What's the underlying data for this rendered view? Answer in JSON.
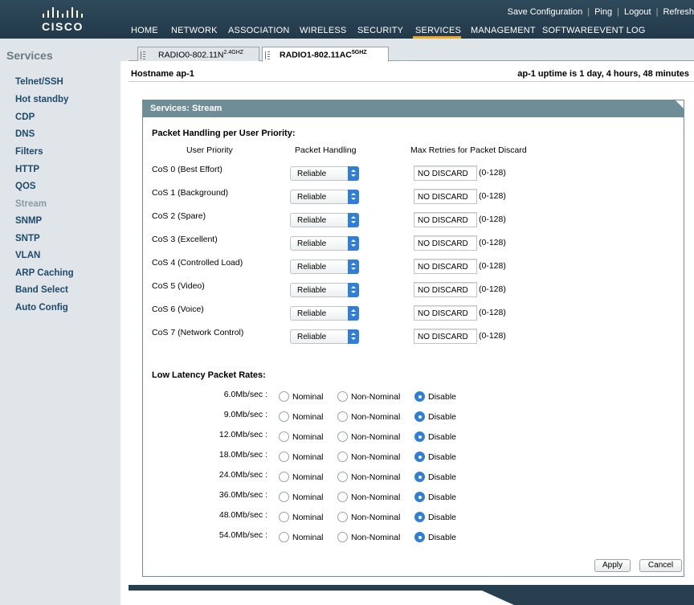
{
  "brand": {
    "name": "CISCO"
  },
  "top_links": [
    "Save Configuration",
    "Ping",
    "Logout",
    "Refresh"
  ],
  "nav": [
    "HOME",
    "NETWORK",
    "ASSOCIATION",
    "WIRELESS",
    "SECURITY",
    "SERVICES",
    "MANAGEMENT",
    "SOFTWARE",
    "EVENT LOG"
  ],
  "nav_active": "SERVICES",
  "accent": "#f5a623",
  "sidebar": {
    "title": "Services",
    "items": [
      "Telnet/SSH",
      "Hot standby",
      "CDP",
      "DNS",
      "Filters",
      "HTTP",
      "QOS",
      "Stream",
      "SNMP",
      "SNTP",
      "VLAN",
      "ARP Caching",
      "Band Select",
      "Auto Config"
    ],
    "current": "Stream"
  },
  "tabs": [
    {
      "label": "RADIO0-802.11N",
      "sup": "2.4GHZ"
    },
    {
      "label": "RADIO1-802.11AC",
      "sup": "5GHZ"
    }
  ],
  "hostname": "Hostname  ap-1",
  "uptime": "ap-1 uptime is 1 day, 4 hours, 48 minutes",
  "panel": {
    "title": "Services: Stream",
    "priority_section": "Packet Handling per User Priority:",
    "col_user_priority": "User Priority",
    "col_packet_handling": "Packet Handling",
    "col_max_retries": "Max Retries for Packet Discard",
    "rows": [
      {
        "cos": "CoS 0 (Best Effort)",
        "handling": "Reliable",
        "retries": "NO DISCARD",
        "range": "(0-128)"
      },
      {
        "cos": "CoS 1 (Background)",
        "handling": "Reliable",
        "retries": "NO DISCARD",
        "range": "(0-128)"
      },
      {
        "cos": "CoS 2 (Spare)",
        "handling": "Reliable",
        "retries": "NO DISCARD",
        "range": "(0-128)"
      },
      {
        "cos": "CoS 3 (Excellent)",
        "handling": "Reliable",
        "retries": "NO DISCARD",
        "range": "(0-128)"
      },
      {
        "cos": "CoS 4 (Controlled Load)",
        "handling": "Reliable",
        "retries": "NO DISCARD",
        "range": "(0-128)"
      },
      {
        "cos": "CoS 5 (Video)",
        "handling": "Reliable",
        "retries": "NO DISCARD",
        "range": "(0-128)"
      },
      {
        "cos": "CoS 6 (Voice)",
        "handling": "Reliable",
        "retries": "NO DISCARD",
        "range": "(0-128)"
      },
      {
        "cos": "CoS 7 (Network Control)",
        "handling": "Reliable",
        "retries": "NO DISCARD",
        "range": "(0-128)"
      }
    ],
    "latency_section": "Low Latency Packet Rates:",
    "rate_options": [
      "Nominal",
      "Non-Nominal",
      "Disable"
    ],
    "rates": [
      {
        "rate": "6.0Mb/sec :",
        "selected": "Disable"
      },
      {
        "rate": "9.0Mb/sec :",
        "selected": "Disable"
      },
      {
        "rate": "12.0Mb/sec :",
        "selected": "Disable"
      },
      {
        "rate": "18.0Mb/sec :",
        "selected": "Disable"
      },
      {
        "rate": "24.0Mb/sec :",
        "selected": "Disable"
      },
      {
        "rate": "36.0Mb/sec :",
        "selected": "Disable"
      },
      {
        "rate": "48.0Mb/sec :",
        "selected": "Disable"
      },
      {
        "rate": "54.0Mb/sec :",
        "selected": "Disable"
      }
    ],
    "apply_label": "Apply",
    "cancel_label": "Cancel"
  }
}
